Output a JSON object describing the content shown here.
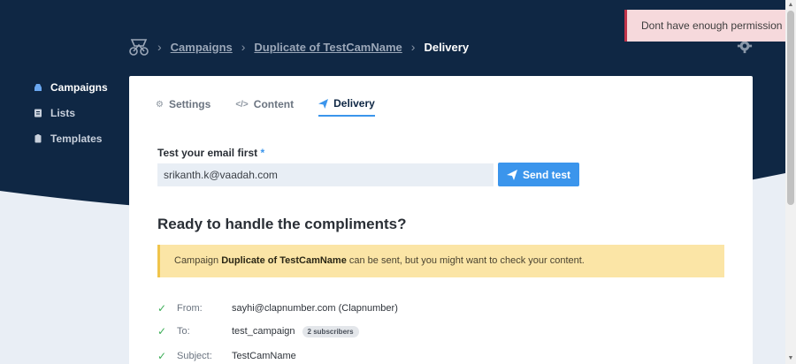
{
  "breadcrumb": {
    "items": [
      "Campaigns",
      "Duplicate of TestCamName"
    ],
    "current": "Delivery"
  },
  "toast": {
    "message": "Dont have enough permission"
  },
  "sidebar": {
    "items": [
      {
        "label": "Campaigns",
        "icon": "inbox-icon",
        "active": true
      },
      {
        "label": "Lists",
        "icon": "list-icon",
        "active": false
      },
      {
        "label": "Templates",
        "icon": "clipboard-icon",
        "active": false
      }
    ]
  },
  "tabs": [
    {
      "label": "Settings",
      "icon": "gear-icon",
      "active": false
    },
    {
      "label": "Content",
      "icon": "code-icon",
      "active": false
    },
    {
      "label": "Delivery",
      "icon": "paper-plane-icon",
      "active": true
    }
  ],
  "test_email": {
    "label": "Test your email first",
    "required_marker": "*",
    "value": "srikanth.k@vaadah.com",
    "button_label": "Send test"
  },
  "ready": {
    "title": "Ready to handle the compliments?",
    "warning_prefix": "Campaign",
    "warning_campaign": "Duplicate of TestCamName",
    "warning_suffix": "can be sent, but you might want to check your content."
  },
  "details": {
    "from_label": "From:",
    "from_value": "sayhi@clapnumber.com (Clapnumber)",
    "to_label": "To:",
    "to_value": "test_campaign",
    "to_badge": "2 subscribers",
    "subject_label": "Subject:",
    "subject_value": "TestCamName"
  },
  "colors": {
    "hero_bg": "#0f2744",
    "accent": "#3b95ec",
    "warning_bg": "#fbe5a6",
    "toast_bg": "#f6d9dc",
    "check": "#3dae58"
  }
}
